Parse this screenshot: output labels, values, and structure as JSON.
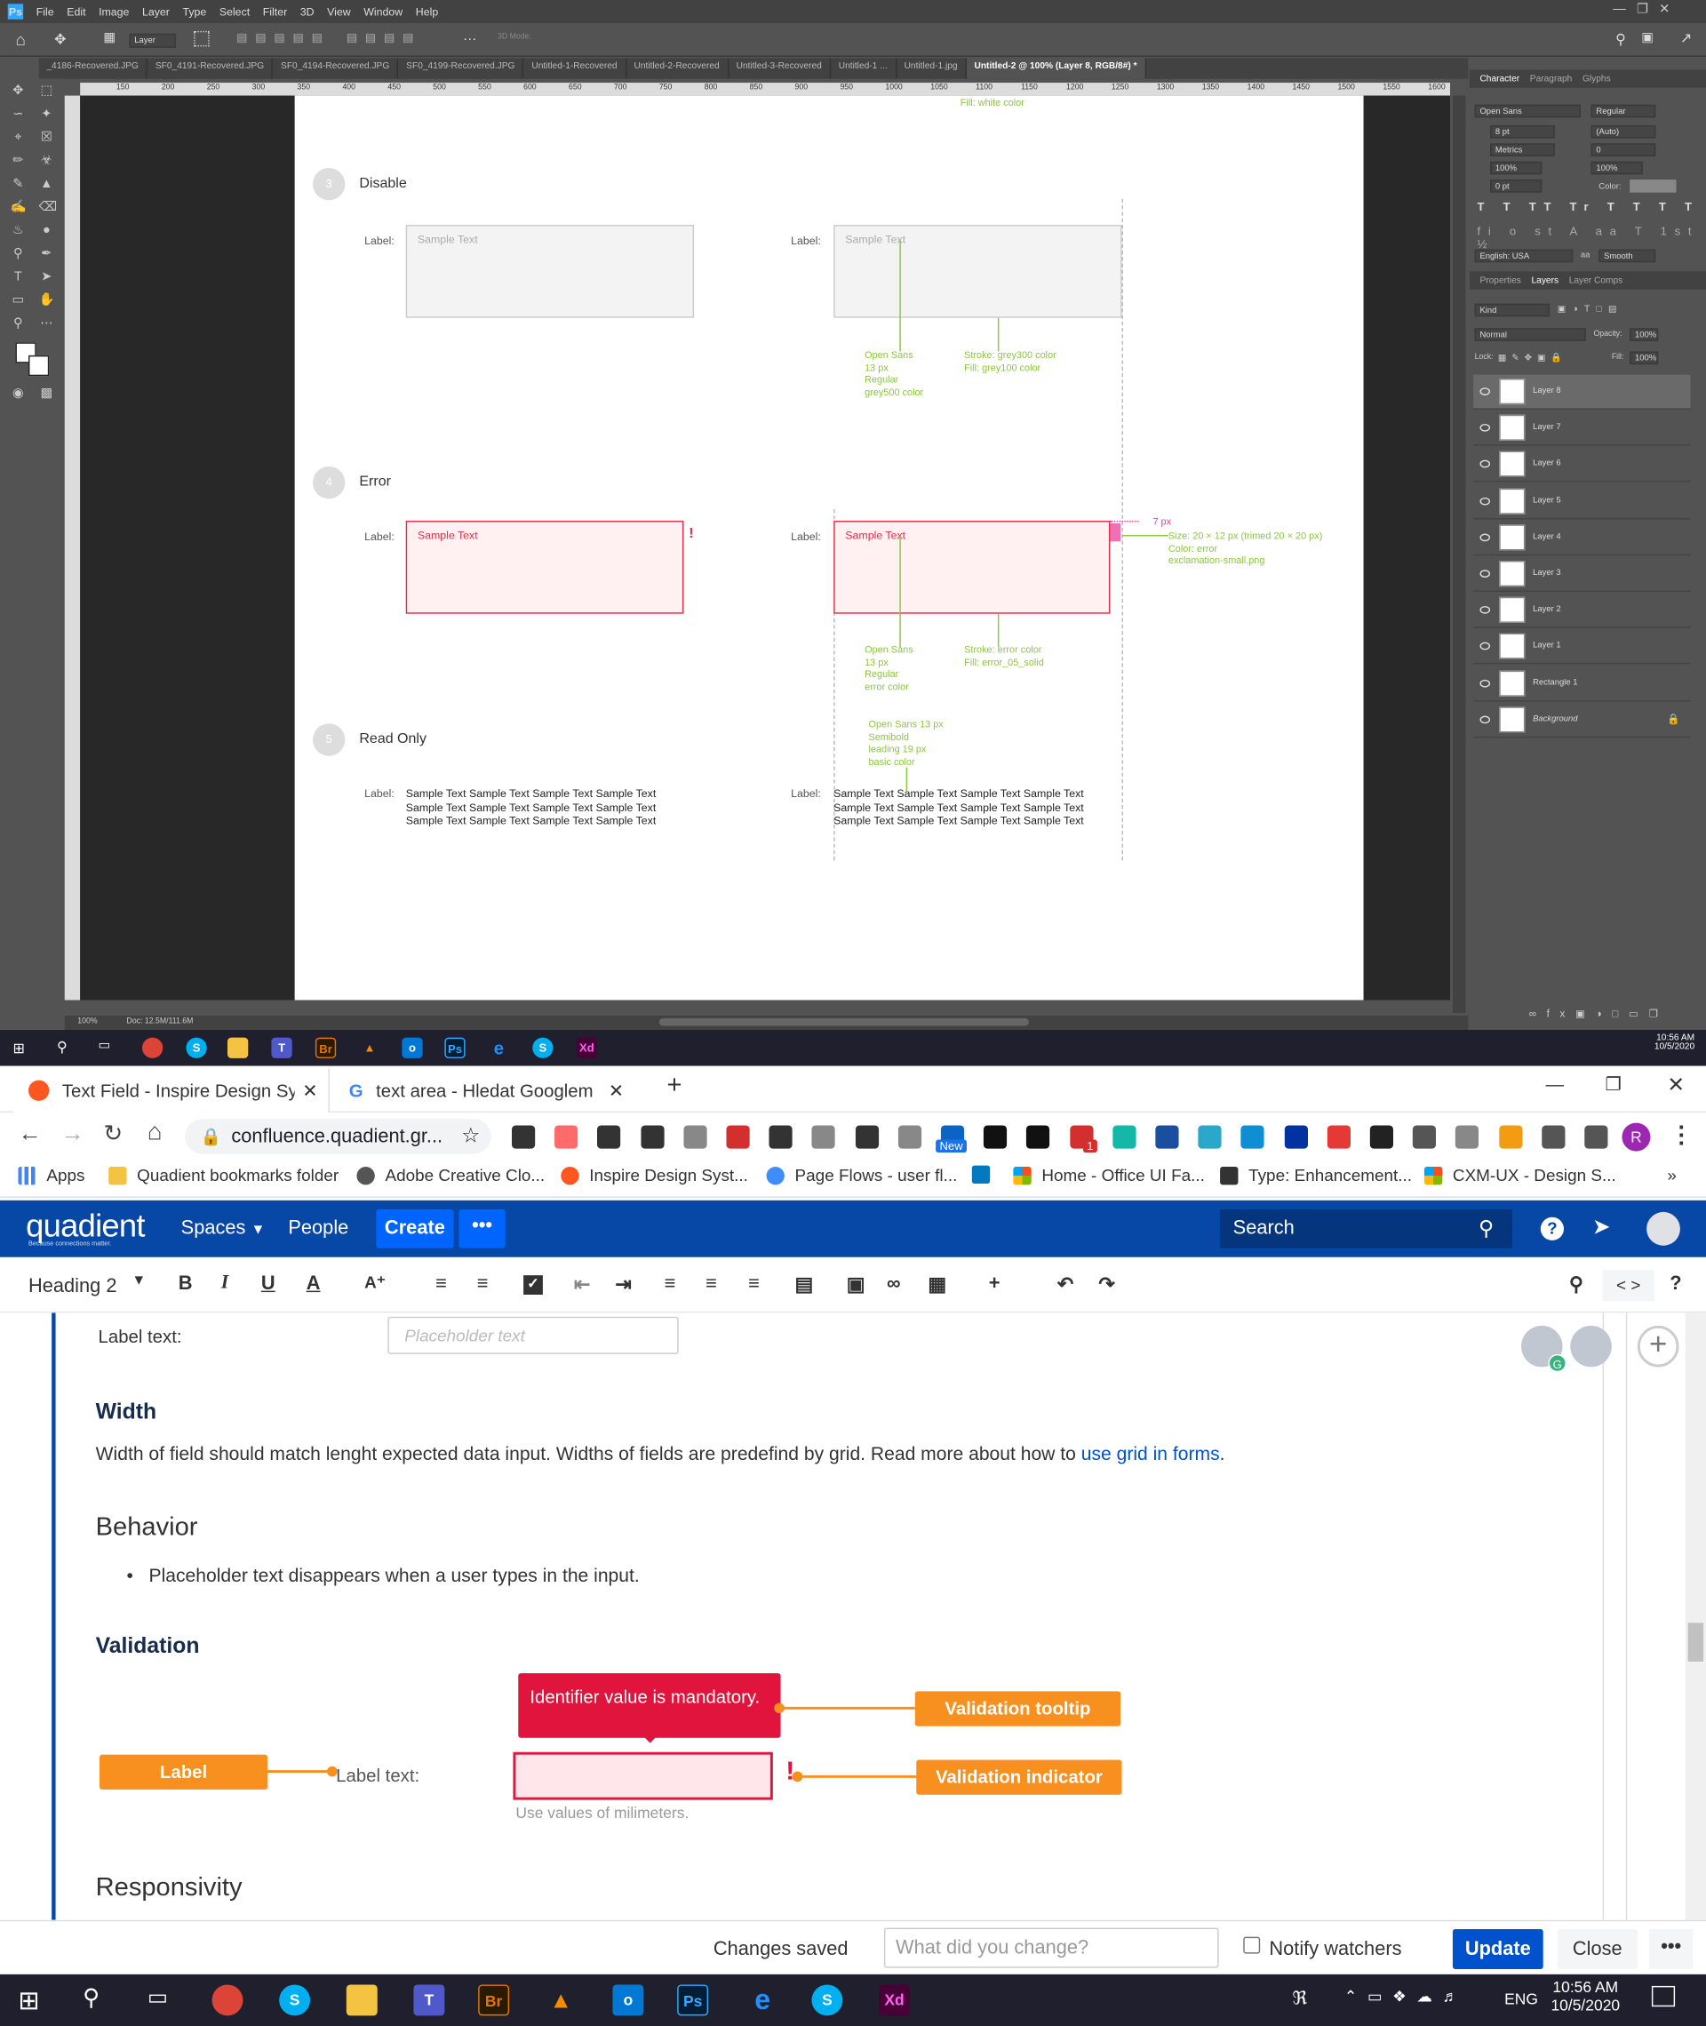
{
  "ps": {
    "menu": [
      "File",
      "Edit",
      "Image",
      "Layer",
      "Type",
      "Select",
      "Filter",
      "3D",
      "View",
      "Window",
      "Help"
    ],
    "logo": "Ps",
    "tool_preset": "Layer",
    "mode3d": "3D Mode:",
    "tabs": [
      "_4186-Recovered.JPG",
      "SF0_4191-Recovered.JPG",
      "SF0_4194-Recovered.JPG",
      "SF0_4199-Recovered.JPG",
      "Untitled-1-Recovered",
      "Untitled-2-Recovered",
      "Untitled-3-Recovered",
      "Untitled-1 ...",
      "Untitled-1.jpg",
      "Untitled-2 @ 100% (Layer 8, RGB/8#) *"
    ],
    "ruler": [
      "150",
      "200",
      "250",
      "300",
      "350",
      "400",
      "450",
      "500",
      "550",
      "600",
      "650",
      "700",
      "750",
      "800",
      "850",
      "900",
      "950",
      "1000",
      "1050",
      "1100",
      "1150",
      "1200",
      "1250",
      "1300",
      "1350",
      "1400",
      "1450",
      "1500",
      "1550",
      "1600"
    ],
    "char_tabs": [
      "Character",
      "Paragraph",
      "Glyphs"
    ],
    "font": "Open Sans",
    "style": "Regular",
    "size": "8 pt",
    "leading": "(Auto)",
    "kerning": "Metrics",
    "tracking": "0",
    "vscale": "100%",
    "hscale": "100%",
    "baseline": "0 pt",
    "color_label": "Color:",
    "lang": "English: USA",
    "aa_label": "aa",
    "aa": "Smooth",
    "layer_tabs": [
      "Properties",
      "Layers",
      "Layer Comps"
    ],
    "kind": "Kind",
    "blend": "Normal",
    "opacity_label": "Opacity:",
    "opacity": "100%",
    "lock_label": "Lock:",
    "fill_label": "Fill:",
    "fill": "100%",
    "layers": [
      "Layer 8",
      "Layer 7",
      "Layer 6",
      "Layer 5",
      "Layer 4",
      "Layer 3",
      "Layer 2",
      "Layer 1",
      "Rectangle 1",
      "Background"
    ],
    "zoom": "100%",
    "doc": "Doc: 12.5M/111.6M",
    "time": "10:56 AM",
    "date": "10/5/2020"
  },
  "docc": {
    "top_note": "Fill: white color",
    "s3": {
      "n": "3",
      "title": "Disable"
    },
    "s4": {
      "n": "4",
      "title": "Error"
    },
    "s5": {
      "n": "5",
      "title": "Read Only"
    },
    "label": "Label:",
    "sample": "Sample Text",
    "excl": "!",
    "a_dis_font": "Open Sans\n13 px\nRegular\ngrey500 color",
    "a_dis_stroke": "Stroke: grey300 color\nFill: grey100 color",
    "a_err_font": "Open Sans\n13 px\nRegular\nerror color",
    "a_err_stroke": "Stroke: error color\nFill: error_05_solid",
    "a_px": "7 px",
    "a_icon": "Size: 20 × 12 px (trimed 20 × 20 px)\nColor: error\nexclamation-small.png",
    "a_ro": "Open Sans 13 px\nSemibold\nleading 19 px\nbasic color",
    "ro_text": "Sample Text Sample Text Sample Text Sample Text\nSample Text Sample Text Sample Text Sample Text\nSample Text Sample Text Sample Text Sample Text"
  },
  "chrome": {
    "tab1": "Text Field - Inspire Design Systen",
    "tab2": "text area - Hledat Googlem",
    "url": "confluence.quadient.gr...",
    "ext_new": "New",
    "ext_badge": "1",
    "profile": "R",
    "bookmarks": [
      "Apps",
      "Quadient bookmarks folder",
      "Adobe Creative Clo...",
      "Inspire Design Syst...",
      "Page Flows - user fl...",
      "Home - Office UI Fa...",
      "Type: Enhancement...",
      "CXM-UX - Design S..."
    ]
  },
  "conf": {
    "logo": "quadient",
    "tagline": "Because connections matter.",
    "nav": [
      "Spaces",
      "People"
    ],
    "create": "Create",
    "search": "Search",
    "heading_sel": "Heading 2",
    "label_text": "Label text:",
    "placeholder": "Placeholder text",
    "width_h": "Width",
    "width_p": "Width of field should match lenght expected data input. Widths of fields are predefind by grid. Read more about how to",
    "width_link": "use grid in forms",
    "behavior_h": "Behavior",
    "behavior_li": "Placeholder text disappears when a user types in the input.",
    "validation_h": "Validation",
    "tooltip": "Identifier value is mandatory.",
    "tag_tooltip": "Validation tooltip",
    "tag_label": "Label",
    "tag_indicator": "Validation indicator",
    "hint": "Use values of milimeters.",
    "responsivity_h": "Responsivity",
    "saved": "Changes saved",
    "change_ph": "What did you change?",
    "notify": "Notify watchers",
    "update": "Update",
    "close": "Close",
    "avatar_badge": "G"
  },
  "taskbar": {
    "lang": "ENG",
    "time": "10:56 AM",
    "date": "10/5/2020"
  }
}
